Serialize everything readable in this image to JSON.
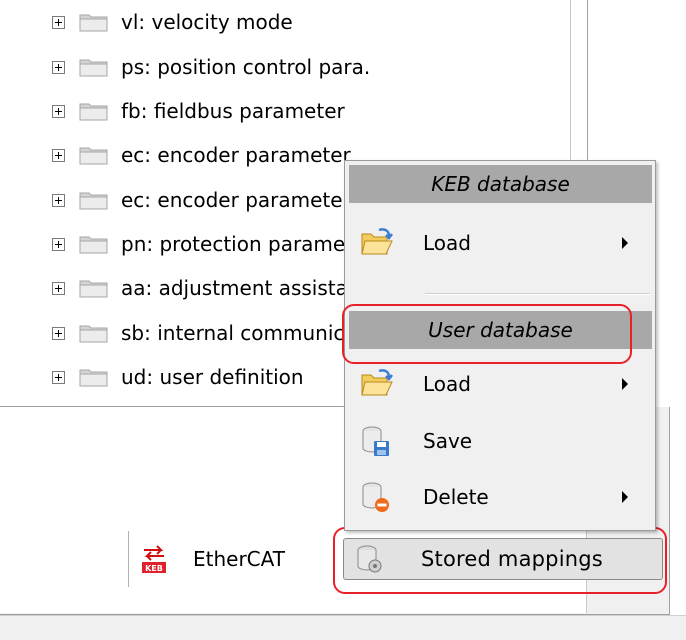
{
  "tree": {
    "items": [
      {
        "label": "vl: velocity mode"
      },
      {
        "label": "ps: position control para."
      },
      {
        "label": "fb: fieldbus parameter"
      },
      {
        "label": "ec: encoder parameter"
      },
      {
        "label": "ec: encoder parameter"
      },
      {
        "label": "pn: protection parameter"
      },
      {
        "label": "aa: adjustment assistant"
      },
      {
        "label": "sb: internal communication"
      },
      {
        "label": "ud: user definition"
      }
    ]
  },
  "status_bar": {
    "ethercat_label": "EtherCAT",
    "stored_mappings_label": "Stored mappings"
  },
  "context_menu": {
    "keb_header": "KEB database",
    "keb_load": "Load",
    "user_header": "User database",
    "user_load": "Load",
    "user_save": "Save",
    "user_delete": "Delete"
  },
  "colors": {
    "highlight": "#e8202a",
    "menu_header_bg": "#a8a8a8",
    "menu_bg": "#f0f0f0",
    "folder": "#e6e6e6"
  }
}
